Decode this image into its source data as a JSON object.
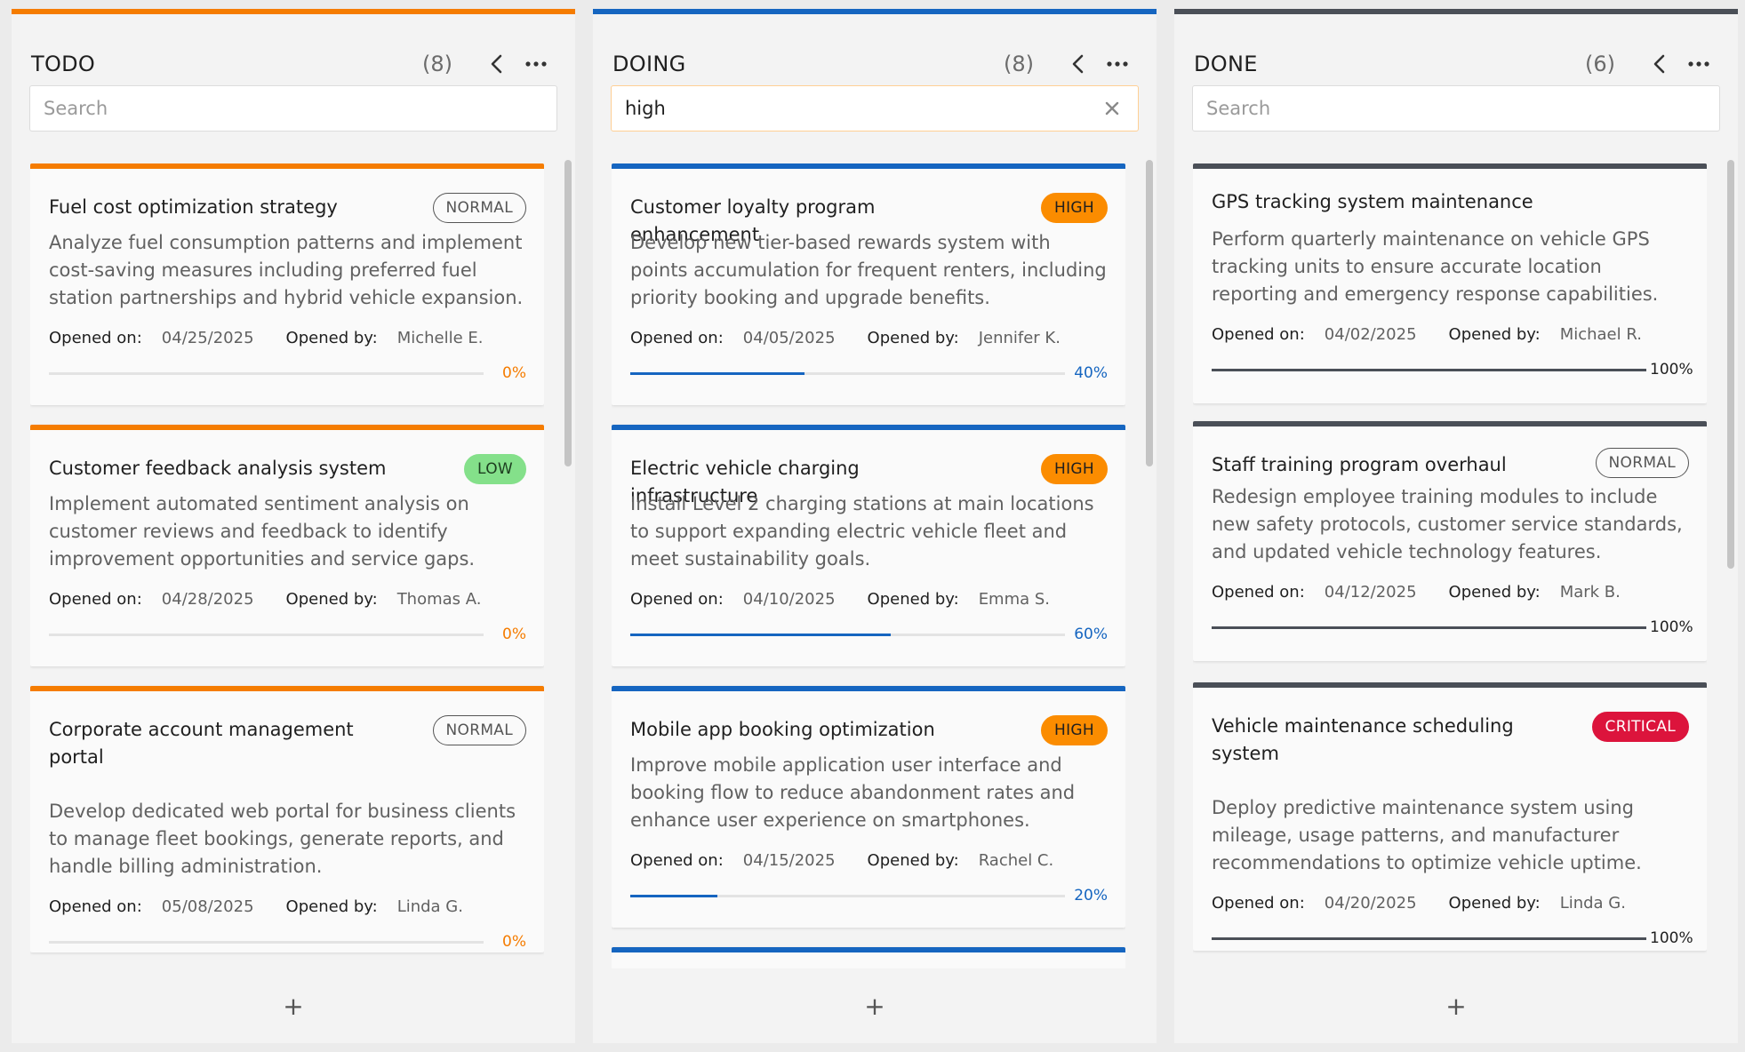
{
  "colors": {
    "todo": "#f57c00",
    "doing": "#1565c0",
    "done": "#4a4f57"
  },
  "icons": {
    "collapse": "chevron-left-icon",
    "menu": "more-horizontal-icon",
    "clear": "close-icon",
    "add": "plus-icon"
  },
  "columns": [
    {
      "title": "TODO",
      "count": "(8)",
      "search": {
        "value": "",
        "placeholder": "Search"
      },
      "add_label": "+",
      "cards": [
        {
          "title": "Fuel cost optimization strategy",
          "priority": "NORMAL",
          "description": "Analyze fuel consumption patterns and implement cost-saving measures including preferred fuel station partnerships and hybrid vehicle expansion.",
          "opened_on_label": "Opened on:",
          "opened_on": "04/25/2025",
          "opened_by_label": "Opened by:",
          "opened_by": "Michelle E.",
          "progress": 0,
          "progress_label": "0%"
        },
        {
          "title": "Customer feedback analysis system",
          "priority": "LOW",
          "description": "Implement automated sentiment analysis on customer reviews and feedback to identify improvement opportunities and service gaps.",
          "opened_on_label": "Opened on:",
          "opened_on": "04/28/2025",
          "opened_by_label": "Opened by:",
          "opened_by": "Thomas A.",
          "progress": 0,
          "progress_label": "0%"
        },
        {
          "title": "Corporate account management portal",
          "priority": "NORMAL",
          "description": "Develop dedicated web portal for business clients to manage fleet bookings, generate reports, and handle billing administration.",
          "opened_on_label": "Opened on:",
          "opened_on": "05/08/2025",
          "opened_by_label": "Opened by:",
          "opened_by": "Linda G.",
          "progress": 0,
          "progress_label": "0%"
        }
      ]
    },
    {
      "title": "DOING",
      "count": "(8)",
      "search": {
        "value": "high",
        "placeholder": "Search"
      },
      "add_label": "+",
      "cards": [
        {
          "title": "Customer loyalty program enhancement",
          "priority": "HIGH",
          "description": "Develop new tier-based rewards system with points accumulation for frequent renters, including priority booking and upgrade benefits.",
          "opened_on_label": "Opened on:",
          "opened_on": "04/05/2025",
          "opened_by_label": "Opened by:",
          "opened_by": "Jennifer K.",
          "progress": 40,
          "progress_label": "40%"
        },
        {
          "title": "Electric vehicle charging infrastructure",
          "priority": "HIGH",
          "description": "Install Level 2 charging stations at main locations to support expanding electric vehicle fleet and meet sustainability goals.",
          "opened_on_label": "Opened on:",
          "opened_on": "04/10/2025",
          "opened_by_label": "Opened by:",
          "opened_by": "Emma S.",
          "progress": 60,
          "progress_label": "60%"
        },
        {
          "title": "Mobile app booking optimization",
          "priority": "HIGH",
          "description": "Improve mobile application user interface and booking flow to reduce abandonment rates and enhance user experience on smartphones.",
          "opened_on_label": "Opened on:",
          "opened_on": "04/15/2025",
          "opened_by_label": "Opened by:",
          "opened_by": "Rachel C.",
          "progress": 20,
          "progress_label": "20%"
        }
      ]
    },
    {
      "title": "DONE",
      "count": "(6)",
      "search": {
        "value": "",
        "placeholder": "Search"
      },
      "add_label": "+",
      "cards": [
        {
          "title": "GPS tracking system maintenance",
          "priority": "",
          "description": "Perform quarterly maintenance on vehicle GPS tracking units to ensure accurate location reporting and emergency response capabilities.",
          "opened_on_label": "Opened on:",
          "opened_on": "04/02/2025",
          "opened_by_label": "Opened by:",
          "opened_by": "Michael R.",
          "progress": 100,
          "progress_label": "100%"
        },
        {
          "title": "Staff training program overhaul",
          "priority": "NORMAL",
          "description": "Redesign employee training modules to include new safety protocols, customer service standards, and updated vehicle technology features.",
          "opened_on_label": "Opened on:",
          "opened_on": "04/12/2025",
          "opened_by_label": "Opened by:",
          "opened_by": "Mark B.",
          "progress": 100,
          "progress_label": "100%"
        },
        {
          "title": "Vehicle maintenance scheduling system",
          "priority": "CRITICAL",
          "description": "Deploy predictive maintenance system using mileage, usage patterns, and manufacturer recommendations to optimize vehicle uptime.",
          "opened_on_label": "Opened on:",
          "opened_on": "04/20/2025",
          "opened_by_label": "Opened by:",
          "opened_by": "Linda G.",
          "progress": 100,
          "progress_label": "100%"
        }
      ]
    }
  ]
}
